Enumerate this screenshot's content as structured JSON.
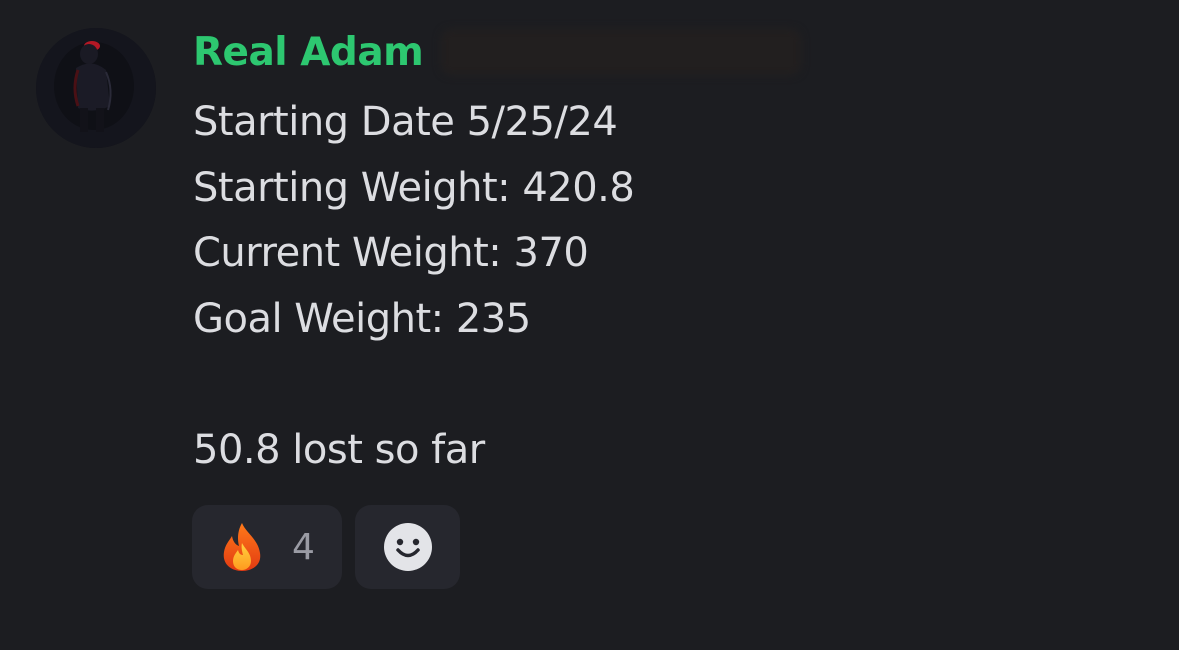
{
  "message": {
    "author": {
      "name": "Real Adam",
      "name_color": "#2dc770",
      "avatar_icon": "user-avatar"
    },
    "lines": [
      "Starting Date 5/25/24",
      "Starting Weight: 420.8",
      "Current Weight: 370",
      "Goal Weight: 235",
      "",
      "50.8 lost so far"
    ],
    "reactions": [
      {
        "emoji": "fire",
        "count": "4"
      },
      {
        "emoji": "add-reaction-smiley"
      }
    ]
  }
}
